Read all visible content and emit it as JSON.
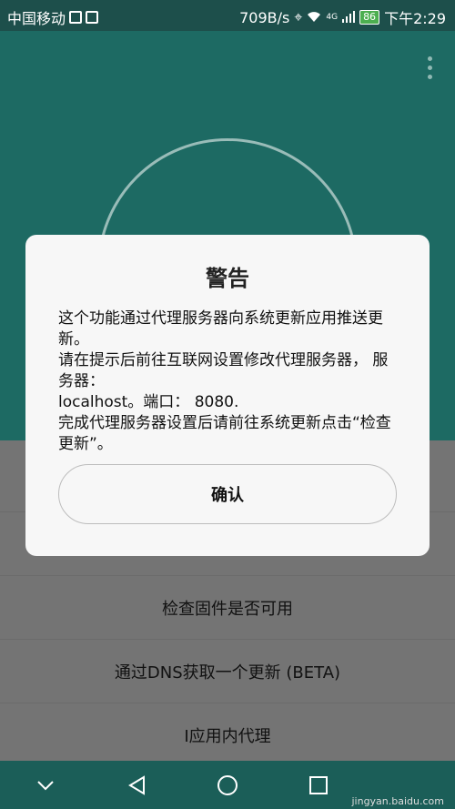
{
  "status_bar": {
    "carrier": "中国移动",
    "speed": "709B/s",
    "network": "4G",
    "battery": "86",
    "time": "下午2:29"
  },
  "menu": {
    "icon": "more-vert-icon"
  },
  "list": {
    "items": [
      {
        "label": "检查固件是否可用"
      },
      {
        "label": "通过DNS获取一个更新 (BETA)"
      },
      {
        "label": "I应用内代理"
      }
    ]
  },
  "dialog": {
    "title": "警告",
    "body": "这个功能通过代理服务器向系统更新应用推送更新。\n请在提示后前往互联网设置修改代理服务器， 服务器：\nlocalhost。端口： 8080.\n完成代理服务器设置后请前往系统更新点击“检查更新”。",
    "confirm_label": "确认"
  },
  "nav": {
    "icons": [
      "chevron-down-icon",
      "back-icon",
      "home-icon",
      "recents-icon"
    ]
  },
  "watermark": "jingyan.baidu.com"
}
